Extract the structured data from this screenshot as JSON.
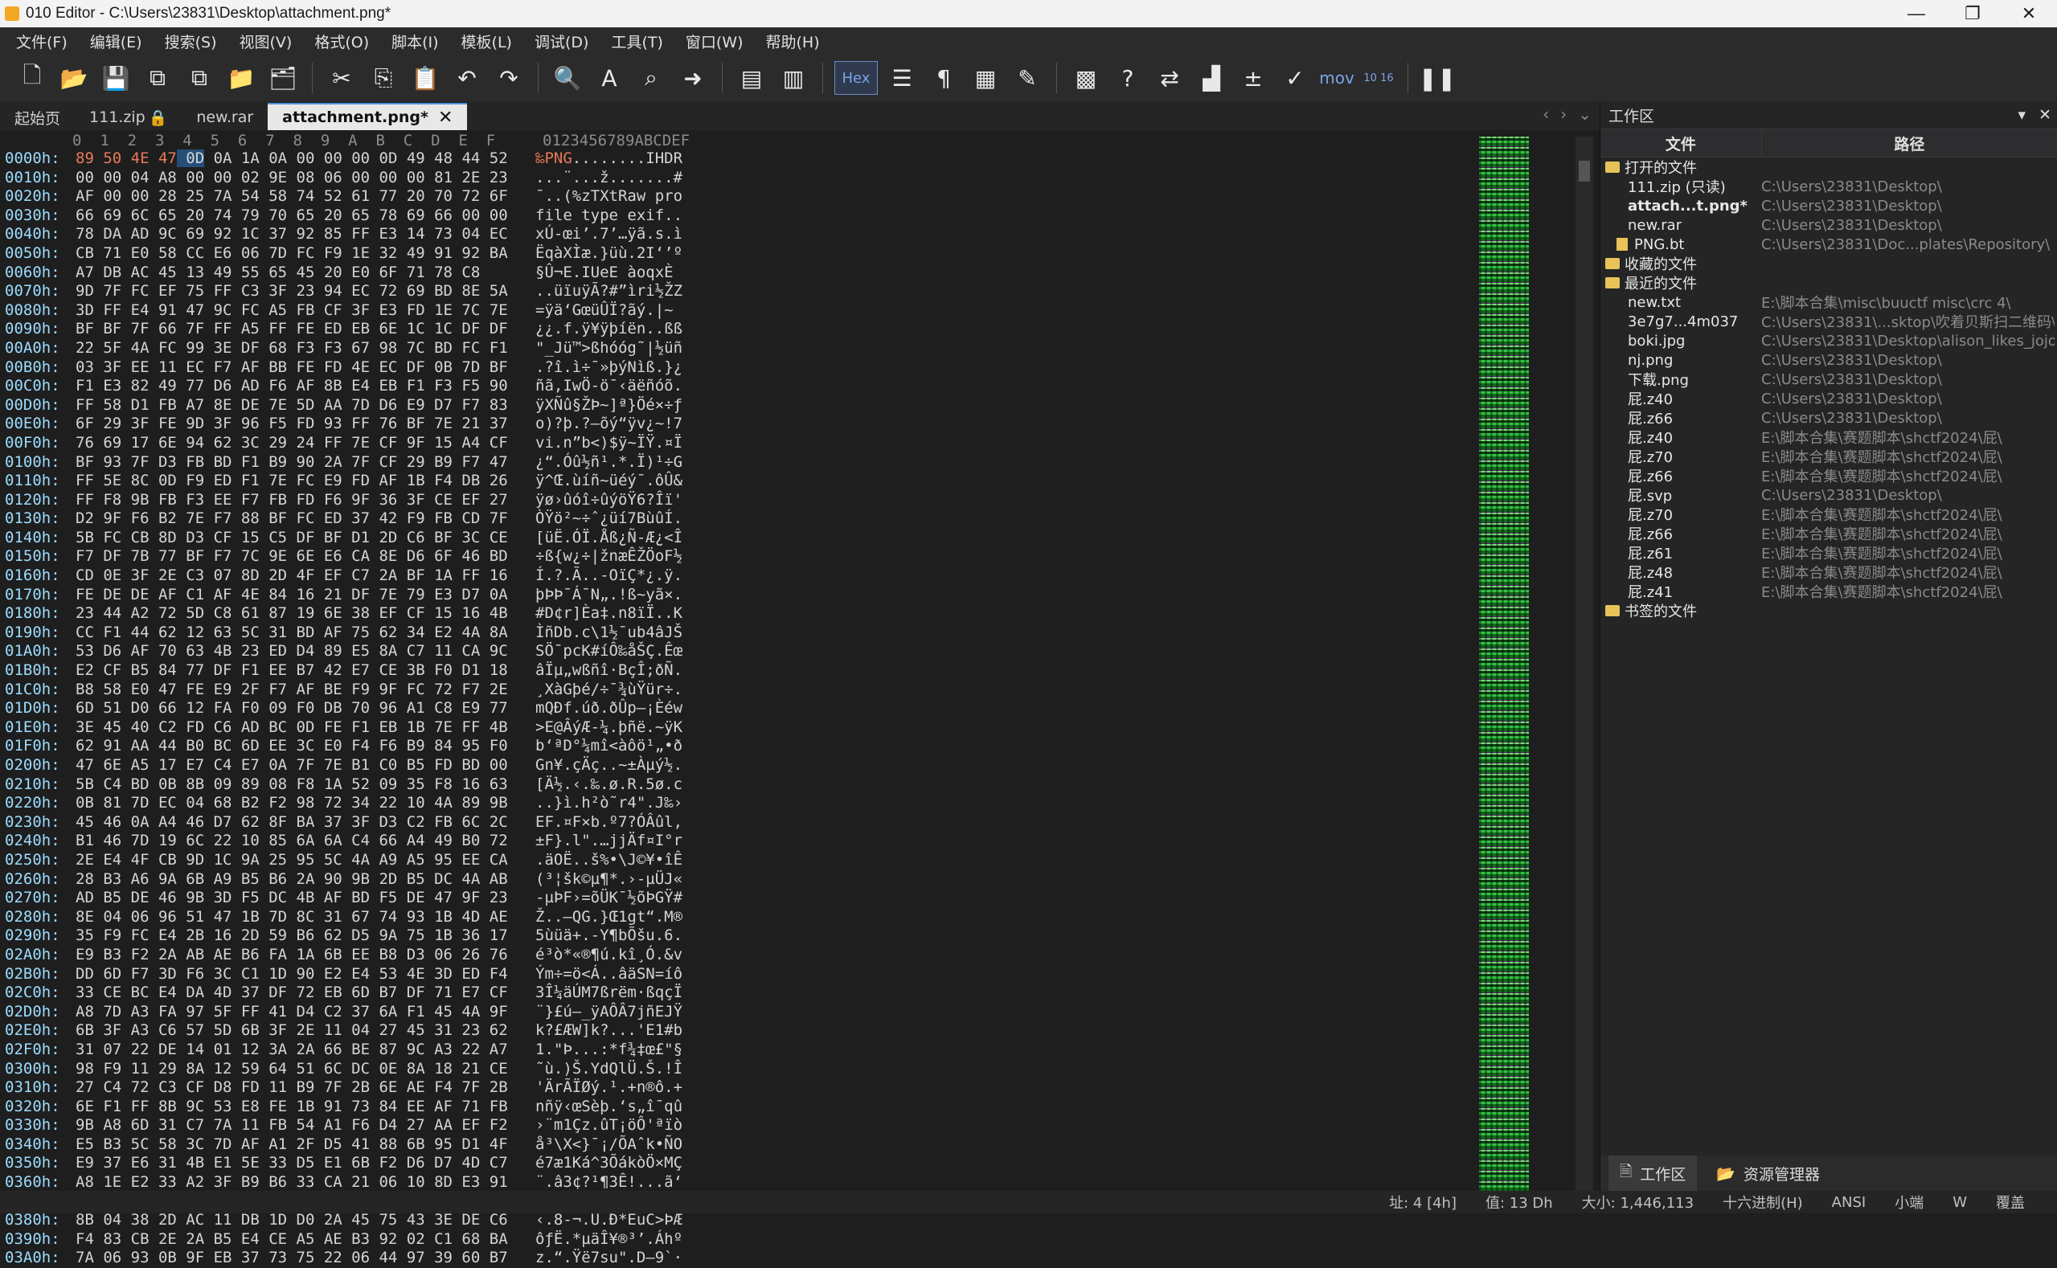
{
  "window": {
    "title": "010 Editor - C:\\Users\\23831\\Desktop\\attachment.png*",
    "controls": [
      "—",
      "❐",
      "✕"
    ]
  },
  "menu": [
    "文件(F)",
    "编辑(E)",
    "搜索(S)",
    "视图(V)",
    "格式(O)",
    "脚本(I)",
    "模板(L)",
    "调试(D)",
    "工具(T)",
    "窗口(W)",
    "帮助(H)"
  ],
  "toolbar": {
    "hex_label": "Hex",
    "mov_label": "mov",
    "num_label": "10 16"
  },
  "tabs": [
    {
      "label": "起始页"
    },
    {
      "label": "111.zip"
    },
    {
      "label": "new.rar"
    },
    {
      "label": "attachment.png*"
    }
  ],
  "hex_header": {
    "columns": "0  1  2  3  4  5  6  7  8  9  A  B  C  D  E  F",
    "ascii_columns": "0123456789ABCDEF"
  },
  "hex_rows": [
    {
      "addr": "0000h:",
      "hex": "89 50 4E 47 0D 0A 1A 0A 00 00 00 0D 49 48 44 52",
      "ascii": "‰PNG........IHDR"
    },
    {
      "addr": "0010h:",
      "hex": "00 00 04 A8 00 00 02 9E 08 06 00 00 00 81 2E 23",
      "ascii": "...¨...ž.......#"
    },
    {
      "addr": "0020h:",
      "hex": "AF 00 00 28 25 7A 54 58 74 52 61 77 20 70 72 6F",
      "ascii": "¯..(%zTXtRaw pro"
    },
    {
      "addr": "0030h:",
      "hex": "66 69 6C 65 20 74 79 70 65 20 65 78 69 66 00 00",
      "ascii": "file type exif.."
    },
    {
      "addr": "0040h:",
      "hex": "78 DA AD 9C 69 92 1C 37 92 85 FF E3 14 73 04 EC",
      "ascii": "xÚ-œi’.7’…ÿã.s.ì"
    },
    {
      "addr": "0050h:",
      "hex": "CB 71 E0 58 CC E6 06 7D FC F9 1E 32 49 91 92 BA",
      "ascii": "ËqàXÌæ.}üù.2I‘’º"
    },
    {
      "addr": "0060h:",
      "hex": "A7 DB AC 45 13 49 55 65 45 20 E0 6F 71 78 C8",
      "ascii": "§Û¬E.IUeE àoqxÈ"
    },
    {
      "addr": "0070h:",
      "hex": "9D 7F FC EF 75 FF C3 3F 23 94 EC 72 69 BD 8E 5A",
      "ascii": "..üïuÿÃ?#”ìri½ŽZ"
    },
    {
      "addr": "0080h:",
      "hex": "3D FF E4 91 47 9C FC A5 FB CF 3F E3 FD 1E 7C 7E",
      "ascii": "=ÿä‘GœüÛÏ?ãý.|~"
    },
    {
      "addr": "0090h:",
      "hex": "BF BF 7F 66 7F FF A5 FF FE ED EB 6E 1C 1C DF DF",
      "ascii": "¿¿.f.ÿ¥ÿþíën..ßß"
    },
    {
      "addr": "00A0h:",
      "hex": "22 5F 4A FC 99 3E DF 68 F3 F3 67 98 7C BD FC F1",
      "ascii": "\"_Jü™>ßhóóg˜|½üñ"
    },
    {
      "addr": "00B0h:",
      "hex": "03 3F EE 11 EC F7 AF BB FE FD 4E EC DF 0B 7D BF",
      "ascii": ".?î.ì÷¯»þýNìß.}¿"
    },
    {
      "addr": "00C0h:",
      "hex": "F1 E3 82 49 77 D6 AD F6 AF 8B E4 EB F1 F3 F5 90",
      "ascii": "ñã‚IwÖ-ö¯‹äëñóõ."
    },
    {
      "addr": "00D0h:",
      "hex": "FF 58 D1 FB A7 8E DE 7E 5D AA 7D D6 E9 D7 F7 83",
      "ascii": "ÿXÑû§ŽÞ~]ª}Öé×÷ƒ"
    },
    {
      "addr": "00E0h:",
      "hex": "6F 29 3F FE 9D 3F 96 F5 FD 93 FF 76 BF 7E 21 37",
      "ascii": "o)?þ.?–õý“ÿv¿~!7"
    },
    {
      "addr": "00F0h:",
      "hex": "76 69 17 6E 94 62 3C 29 24 FF 7E CF 9F 15 A4 CF",
      "ascii": "vi.n”b<)$ÿ~ÏŸ.¤Ï"
    },
    {
      "addr": "0100h:",
      "hex": "BF 93 7F D3 FB BD F1 B9 90 2A 7F CF 29 B9 F7 47",
      "ascii": "¿“.Óû½ñ¹.*.Ï)¹÷G"
    },
    {
      "addr": "0110h:",
      "hex": "FF 5E 8C 0D F9 ED F1 7E FC E9 FD AF 1B F4 DB 26",
      "ascii": "ÿ^Œ.ùíñ~üéý¯.ôÛ&"
    },
    {
      "addr": "0120h:",
      "hex": "FF F8 9B FB F3 EE F7 FB FD F6 9F 36 3F CE EF 27",
      "ascii": "ÿø›ûóî÷ûýöŸ6?Îï'"
    },
    {
      "addr": "0130h:",
      "hex": "D2 9F F6 B2 7E F7 88 BF FC ED 37 42 F9 FB CD 7F",
      "ascii": "ÒŸö²~÷ˆ¿üí7BùûÍ."
    },
    {
      "addr": "0140h:",
      "hex": "5B FC CB 8D D3 CF 15 C5 DF BF D1 2D C6 BF 3C CE",
      "ascii": "[üË.ÓÏ.Åß¿Ñ-Æ¿<Î"
    },
    {
      "addr": "0150h:",
      "hex": "F7 DF 7B 77 BF F7 7C 9E 6E E6 CA 8E D6 6F 46 BD",
      "ascii": "÷ß{w¿÷|žnæÊŽÖoF½"
    },
    {
      "addr": "0160h:",
      "hex": "CD 0E 3F 2E C3 07 8D 2D 4F EF C7 2A BF 1A FF 16",
      "ascii": "Í.?.Ã..-OïÇ*¿.ÿ."
    },
    {
      "addr": "0170h:",
      "hex": "FE DE DE AF C1 AF 4E 84 16 21 DF 7E 79 E3 D7 0A",
      "ascii": "þÞÞ¯Á¯N„.!ß~yã×."
    },
    {
      "addr": "0180h:",
      "hex": "23 44 A2 72 5D C8 61 87 19 6E 38 EF CF 15 16 4B",
      "ascii": "#D¢r]Èa‡.n8ïÏ..K"
    },
    {
      "addr": "0190h:",
      "hex": "CC F1 44 62 12 63 5C 31 BD AF 75 62 34 E2 4A 8A",
      "ascii": "ÌñDb.c\\1½¯ub4âJŠ"
    },
    {
      "addr": "01A0h:",
      "hex": "53 D6 AF 70 63 4B 23 ED D4 89 E5 8A C7 11 CA 9C",
      "ascii": "SÖ¯pcK#íÔ‰åŠÇ.Êœ"
    },
    {
      "addr": "01B0h:",
      "hex": "E2 CF B5 84 77 DF F1 EE B7 42 E7 CE 3B F0 D1 18",
      "ascii": "âÏµ„wßñî·BçÎ;ðÑ."
    },
    {
      "addr": "01C0h:",
      "hex": "B8 58 E0 47 FE E9 2F F7 AF BE F9 9F FC 72 F7 2E",
      "ascii": "¸XàGþé/÷¯¾ùŸür÷."
    },
    {
      "addr": "01D0h:",
      "hex": "6D 51 D0 66 12 FA F0 09 F0 DB 70 96 A1 C8 E9 77",
      "ascii": "mQÐf.úð.ðÛp–¡Èéw"
    },
    {
      "addr": "01E0h:",
      "hex": "3E 45 40 C2 FD C6 AD BC 0D FE F1 EB 1B 7E FF 4B",
      "ascii": ">E@ÂýÆ-¼.þñë.~ÿK"
    },
    {
      "addr": "01F0h:",
      "hex": "62 91 AA 44 B0 BC 6D EE 3C E0 F4 F6 B9 84 95 F0",
      "ascii": "b‘ªD°¼mî<àôö¹„•ð"
    },
    {
      "addr": "0200h:",
      "hex": "47 6E A5 17 E7 C4 E7 0A 7F 7E B1 C0 B5 FD BD 00",
      "ascii": "Gn¥.çÄç..~±Àµý½."
    },
    {
      "addr": "0210h:",
      "hex": "5B C4 BD 0B 8B 09 89 08 F8 1A 52 09 35 F8 16 63",
      "ascii": "[Ä½.‹.‰.ø.R.5ø.c"
    },
    {
      "addr": "0220h:",
      "hex": "0B 81 7D EC 04 68 B2 F2 98 72 34 22 10 4A 89 9B",
      "ascii": "..}ì.h²ò˜r4\".J‰›"
    },
    {
      "addr": "0230h:",
      "hex": "45 46 0A A4 46 D7 62 8F BA 37 3F D3 C2 FB 6C 2C",
      "ascii": "EF.¤F×b.º7?ÓÂûl,"
    },
    {
      "addr": "0240h:",
      "hex": "B1 46 7D 19 6C 22 10 85 6A 6A C4 66 A4 49 B0 72",
      "ascii": "±F}.l\".…jjÄf¤I°r"
    },
    {
      "addr": "0250h:",
      "hex": "2E E4 4F CB 9D 1C 9A 25 95 5C 4A A9 A5 95 EE CA",
      "ascii": ".äOË..š%•\\J©¥•îÊ"
    },
    {
      "addr": "0260h:",
      "hex": "28 B3 A6 9A 6B A9 B5 B6 2A 90 9B 2D B5 DC 4A AB",
      "ascii": "(³¦šk©µ¶*.›-µÜJ«"
    },
    {
      "addr": "0270h:",
      "hex": "AD B5 DE 46 9B 3D F5 DC 4B AF BD F5 DE 47 9F 23",
      "ascii": "-µÞF›=õÜK¯½õÞGŸ#"
    },
    {
      "addr": "0280h:",
      "hex": "8E 04 06 96 51 47 1B 7D 8C 31 67 74 93 1B 4D AE",
      "ascii": "Ž..–QG.}Œ1gt“.M®"
    },
    {
      "addr": "0290h:",
      "hex": "35 F9 FC E4 2B 16 2D 59 B6 62 D5 9A 75 1B 36 17",
      "ascii": "5ùüä+.-Y¶bÕšu.6."
    },
    {
      "addr": "02A0h:",
      "hex": "E9 B3 F2 2A AB AE B6 FA 1A 6B EE B8 D3 06 26 76",
      "ascii": "é³ò*«®¶ú.kî¸Ó.&v"
    },
    {
      "addr": "02B0h:",
      "hex": "DD 6D F7 3D F6 3C C1 1D 90 E2 E4 53 4E 3D ED F4",
      "ascii": "Ým÷=ö<Á..âäSN=íô"
    },
    {
      "addr": "02C0h:",
      "hex": "33 CE BC E4 DA 4D 37 DF 72 EB 6D B7 DF 71 E7 CF",
      "ascii": "3Î¼äÚM7ßrëm·ßqçÏ"
    },
    {
      "addr": "02D0h:",
      "hex": "A8 7D A3 FA 97 5F FF 41 D4 C2 37 6A F1 45 4A 9F",
      "ascii": "¨}£ú—_ÿAÔÂ7jñEJŸ"
    },
    {
      "addr": "02E0h:",
      "hex": "6B 3F A3 C6 57 5D 6B 3F 2E 11 04 27 45 31 23 62",
      "ascii": "k?£ÆW]k?...'E1#b"
    },
    {
      "addr": "02F0h:",
      "hex": "31 07 22 DE 14 01 12 3A 2A 66 BE 87 9C A3 22 A7",
      "ascii": "1.\"Þ...:*f¾‡œ£\"§"
    },
    {
      "addr": "0300h:",
      "hex": "98 F9 11 29 8A 12 59 64 51 6C DC 0E 8A 18 21 CE",
      "ascii": "˜ù.)Š.YdQlÜ.Š.!Î"
    },
    {
      "addr": "0310h:",
      "hex": "27 C4 72 C3 CF D8 FD 11 B9 7F 2B 6E AE F4 7F 2B",
      "ascii": "'ÄrÃÏØý.¹.+n®ô.+"
    },
    {
      "addr": "0320h:",
      "hex": "6E F1 FF 8B 9C 53 E8 FE 1B 91 73 84 EE AF 71 FB",
      "ascii": "nñÿ‹œSèþ.‘s„î¯qû"
    },
    {
      "addr": "0330h:",
      "hex": "9B A8 6D 31 C7 7A 11 FB 54 A1 F6 D4 27 AA EF F2",
      "ascii": "›¨m1Çz.ûT¡öÔ'ªïò"
    },
    {
      "addr": "0340h:",
      "hex": "E5 B3 5C 58 3C 7D AF A1 2F D5 41 88 6B 95 D1 4F",
      "ascii": "å³\\X<}¯¡/ÕAˆk•ÑO"
    },
    {
      "addr": "0350h:",
      "hex": "E9 37 E6 31 4B E1 5E 33 D5 E1 6B F2 D6 D7 4D C7",
      "ascii": "é7æ1Ká^3ÕákòÖ×MÇ"
    },
    {
      "addr": "0360h:",
      "hex": "A8 1E E2 33 A2 3F B9 B6 33 CA 21 06 10 8D E3 91",
      "ascii": "¨.â3¢?¹¶3Ê!...ã‘"
    },
    {
      "addr": "0370h:",
      "hex": "DA 5C F3 58 48 AB FA BB E6 ED AB DF 59 FC 36 F6",
      "ascii": "Ú\\óXH«ú»æí«ßYü6ö"
    },
    {
      "addr": "0380h:",
      "hex": "8B 04 38 2D AC 11 DB 1D D0 2A 45 75 43 3E DE C6",
      "ascii": "‹.8-¬.Û.Ð*EuC>ÞÆ"
    },
    {
      "addr": "0390h:",
      "hex": "F4 83 CB 2E 2A B5 E4 CE A5 AE B3 92 02 C1 68 BA",
      "ascii": "ôƒË.*µäÎ¥®³’.Áhº"
    },
    {
      "addr": "03A0h:",
      "hex": "7A 06 93 0B 9F EB 37 73 75 22 06 44 97 39 60 B7",
      "ascii": "z.“.Ÿë7su\".D—9`·"
    }
  ],
  "workspace": {
    "title": "工作区",
    "col_file": "文件",
    "col_path": "路径",
    "tree": [
      {
        "kind": "folder",
        "name": "打开的文件",
        "path": ""
      },
      {
        "kind": "file",
        "name": "111.zip (只读)",
        "path": "C:\\Users\\23831\\Desktop\\"
      },
      {
        "kind": "file-active",
        "name": "attach...t.png*",
        "path": "C:\\Users\\23831\\Desktop\\"
      },
      {
        "kind": "file",
        "name": "new.rar",
        "path": "C:\\Users\\23831\\Desktop\\"
      },
      {
        "kind": "template",
        "name": "PNG.bt",
        "path": "C:\\Users\\23831\\Doc...plates\\Repository\\"
      },
      {
        "kind": "folder",
        "name": "收藏的文件",
        "path": ""
      },
      {
        "kind": "folder",
        "name": "最近的文件",
        "path": ""
      },
      {
        "kind": "file",
        "name": "new.txt",
        "path": "E:\\脚本合集\\misc\\buuctf misc\\crc 4\\"
      },
      {
        "kind": "file",
        "name": "3e7g7...4m037",
        "path": "C:\\Users\\23831\\...sktop\\吹着贝斯扫二维码\\"
      },
      {
        "kind": "file",
        "name": "boki.jpg",
        "path": "C:\\Users\\23831\\Desktop\\alison_likes_jojo\\"
      },
      {
        "kind": "file",
        "name": "nj.png",
        "path": "C:\\Users\\23831\\Desktop\\"
      },
      {
        "kind": "file",
        "name": "下载.png",
        "path": "C:\\Users\\23831\\Desktop\\"
      },
      {
        "kind": "file",
        "name": "屁.z40",
        "path": "C:\\Users\\23831\\Desktop\\"
      },
      {
        "kind": "file",
        "name": "屁.z66",
        "path": "C:\\Users\\23831\\Desktop\\"
      },
      {
        "kind": "file",
        "name": "屁.z40",
        "path": "E:\\脚本合集\\赛题脚本\\shctf2024\\屁\\"
      },
      {
        "kind": "file",
        "name": "屁.z70",
        "path": "E:\\脚本合集\\赛题脚本\\shctf2024\\屁\\"
      },
      {
        "kind": "file",
        "name": "屁.z66",
        "path": "E:\\脚本合集\\赛题脚本\\shctf2024\\屁\\"
      },
      {
        "kind": "file",
        "name": "屁.svp",
        "path": "C:\\Users\\23831\\Desktop\\"
      },
      {
        "kind": "file",
        "name": "屁.z70",
        "path": "E:\\脚本合集\\赛题脚本\\shctf2024\\屁\\"
      },
      {
        "kind": "file",
        "name": "屁.z66",
        "path": "E:\\脚本合集\\赛题脚本\\shctf2024\\屁\\"
      },
      {
        "kind": "file",
        "name": "屁.z61",
        "path": "E:\\脚本合集\\赛题脚本\\shctf2024\\屁\\"
      },
      {
        "kind": "file",
        "name": "屁.z48",
        "path": "E:\\脚本合集\\赛题脚本\\shctf2024\\屁\\"
      },
      {
        "kind": "file",
        "name": "屁.z41",
        "path": "E:\\脚本合集\\赛题脚本\\shctf2024\\屁\\"
      },
      {
        "kind": "folder",
        "name": "书签的文件",
        "path": ""
      }
    ],
    "bottom_tabs": [
      "工作区",
      "资源管理器"
    ]
  },
  "statusbar": [
    "址: 4 [4h]",
    "值: 13 Dh",
    "大小: 1,446,113",
    "十六进制(H)",
    "ANSI",
    "小端",
    "W",
    "覆盖"
  ]
}
